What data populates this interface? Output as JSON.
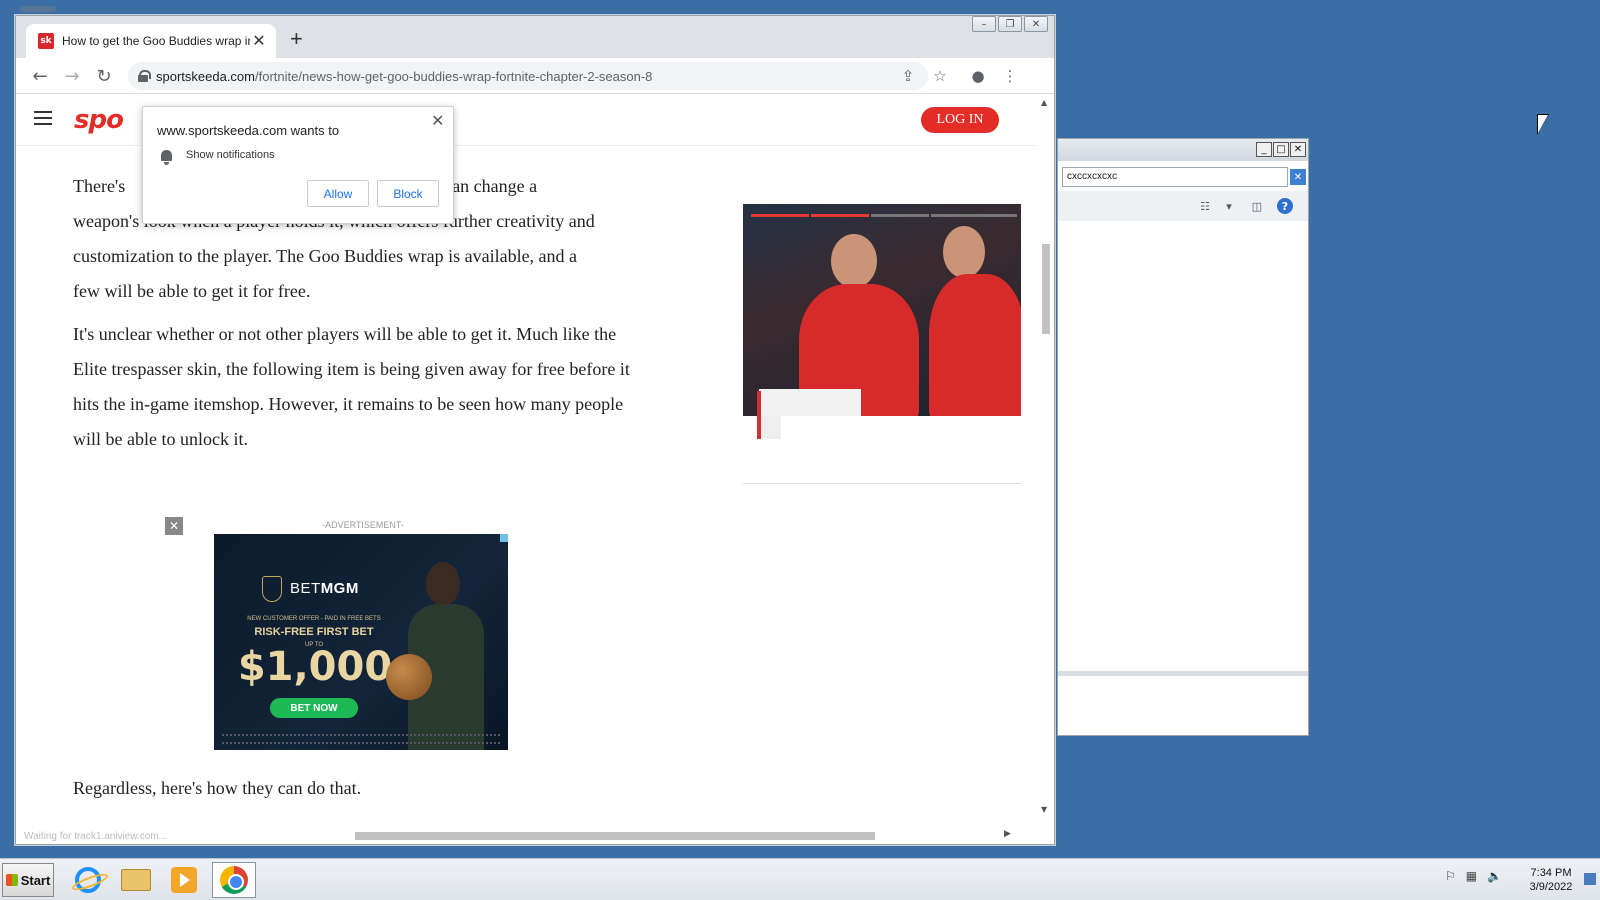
{
  "browser": {
    "tab_title": "How to get the Goo Buddies wrap in",
    "tab_favicon": "sk",
    "new_tab": "+",
    "url_host": "sportskeeda.com",
    "url_path": "/fortnite/news-how-get-goo-buddies-wrap-fortnite-chapter-2-season-8",
    "status_text": "Waiting for track1.aniview.com..."
  },
  "site": {
    "logo": "spo",
    "login_label": "LOG IN"
  },
  "article": {
    "p1": "There's ... n wraps can change a weapon's look when a player holds it, which offers further creativity and customization to the player. The Goo Buddies wrap is available, and a few will be able to get it for free.",
    "p1_visible": "There's",
    "p1_rest": "n wraps can change a",
    "p1_line2": "weapon's look when a player holds it, which offers further creativity and",
    "p1_line3": "customization to the player. The Goo Buddies wrap is available, and a",
    "p1_line4": "few will be able to get it for free.",
    "p2": "It's unclear whether or not other players will be able to get it. Much like the Elite trespasser skin, the following item is being given away for free before it hits the in-game itemshop. However, it remains to be seen how many people will be able to unlock it.",
    "p3": "Regardless, here's how they can do that."
  },
  "ad": {
    "label": "-ADVERTISEMENT-",
    "close": "✕",
    "brand_prefix": "BET",
    "brand_bold": "MGM",
    "offer": "NEW CUSTOMER OFFER - PAID IN FREE BETS",
    "headline": "RISK-FREE FIRST BET",
    "upto": "UP TO",
    "amount": "$1,000",
    "cta": "BET NOW"
  },
  "notification": {
    "title": "www.sportskeeda.com wants to",
    "permission": "Show notifications",
    "allow": "Allow",
    "block": "Block",
    "close": "✕"
  },
  "dialog": {
    "search_value": "cxccxcxcxc"
  },
  "taskbar": {
    "start": "Start",
    "time": "7:34 PM",
    "date": "3/9/2022"
  },
  "colors": {
    "desktop": "#3a6ea5",
    "accent_red": "#e52d27",
    "link_blue": "#1a73e8"
  }
}
